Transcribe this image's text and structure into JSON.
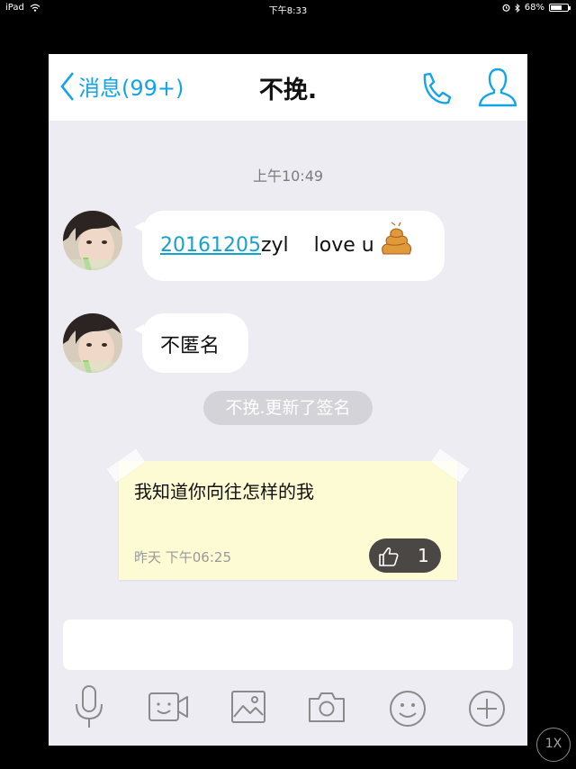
{
  "status_bar": {
    "device": "iPad",
    "time": "下午8:33",
    "battery": "68%",
    "battery_level": 0.68
  },
  "nav": {
    "back_label": "消息(99+)",
    "title": "不挽."
  },
  "chat": {
    "timestamp": "上午10:49",
    "messages": [
      {
        "link_text": "20161205",
        "text": "zyl    love u",
        "emoji": "poop"
      },
      {
        "text": "不匿名"
      }
    ],
    "system_notice": "不挽.更新了签名",
    "signature_card": {
      "text": "我知道你向往怎样的我",
      "date": "昨天 下午06:25",
      "like_count": "1"
    }
  },
  "input": {
    "value": "",
    "placeholder": ""
  },
  "toolbar": [
    "voice-icon",
    "video-icon",
    "image-icon",
    "camera-icon",
    "emoji-icon",
    "plus-icon"
  ],
  "overlay": {
    "zoom_label": "1X"
  },
  "colors": {
    "accent": "#12a4e6",
    "link": "#18a1cf",
    "chat_bg": "#ececf2",
    "note_bg": "#fdfbd4"
  }
}
